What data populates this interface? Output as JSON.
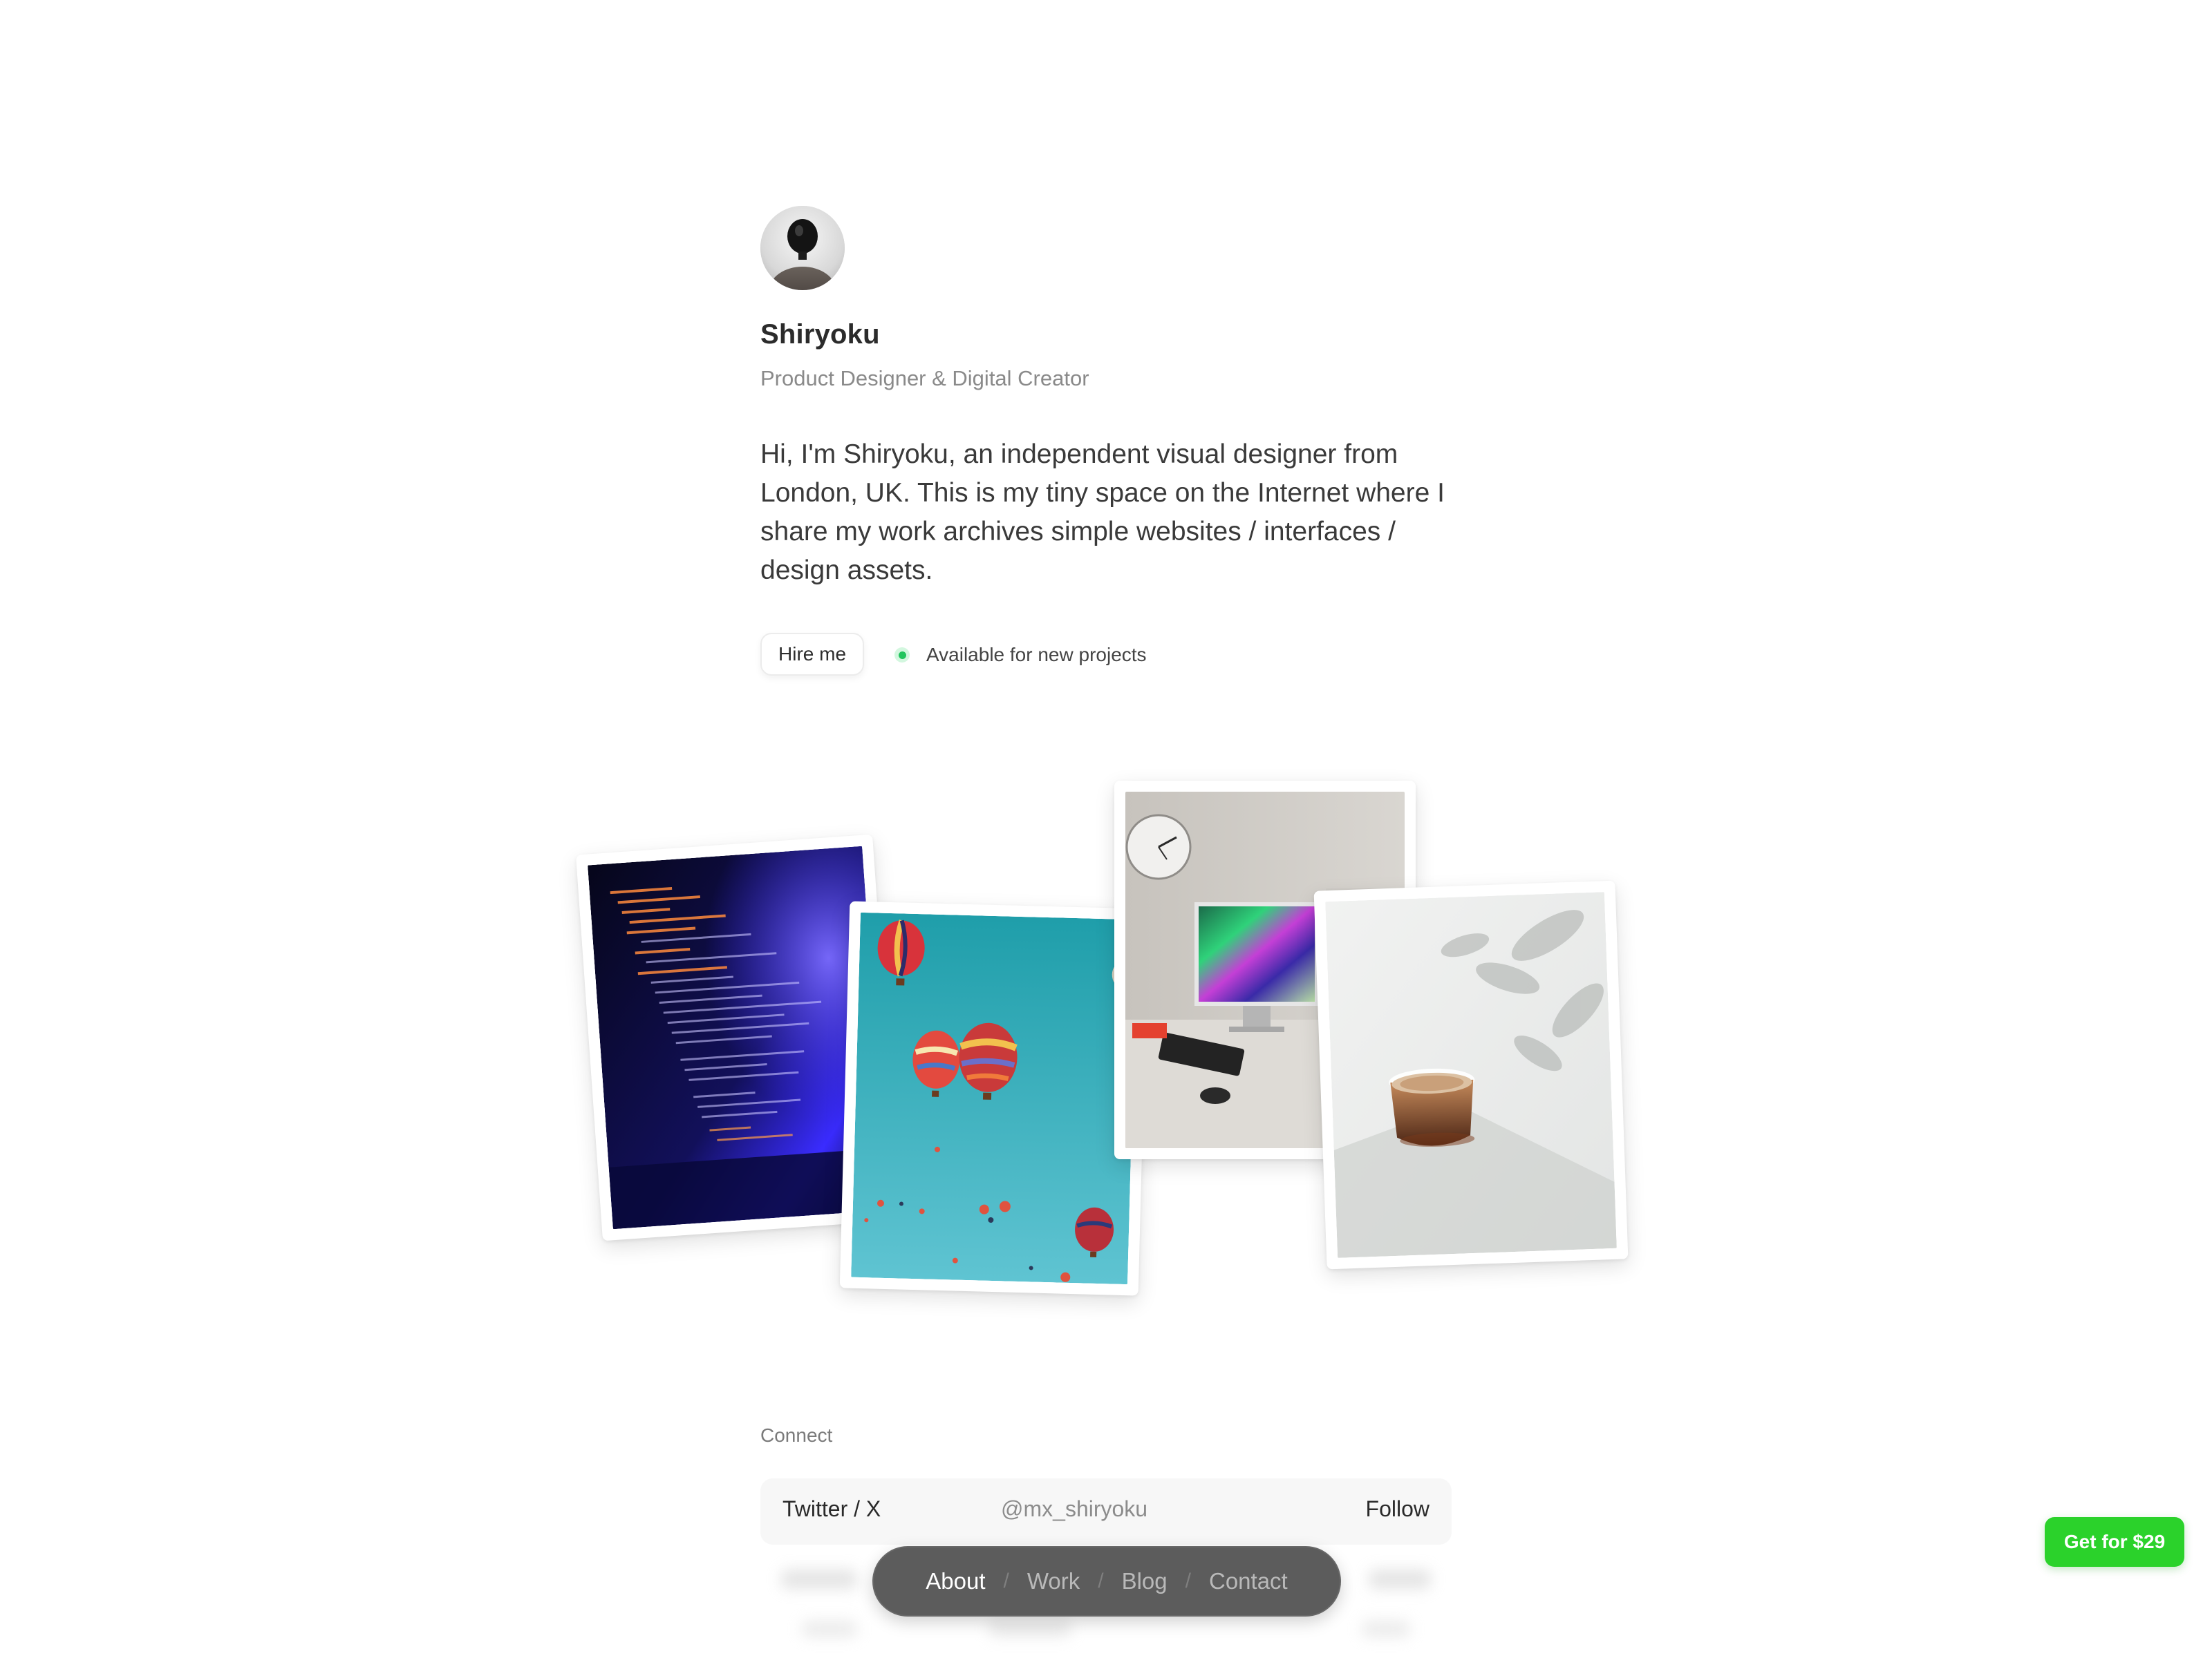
{
  "profile": {
    "name": "Shiryoku",
    "role": "Product Designer & Digital Creator",
    "bio": "Hi, I'm Shiryoku, an independent visual designer from London, UK. This is my tiny space on the Internet where I share my work archives simple websites / interfaces / design assets."
  },
  "actions": {
    "hire_label": "Hire me",
    "status_text": "Available for new projects",
    "status_color": "#22c55e"
  },
  "gallery": [
    {
      "name": "code-screen-photo"
    },
    {
      "name": "hot-air-balloons-photo"
    },
    {
      "name": "desk-setup-photo"
    },
    {
      "name": "coffee-glass-photo"
    }
  ],
  "connect": {
    "label": "Connect",
    "rows": [
      {
        "platform": "Twitter / X",
        "handle": "@mx_shiryoku",
        "action": "Follow"
      }
    ]
  },
  "nav": {
    "items": [
      {
        "label": "About",
        "active": true
      },
      {
        "label": "Work",
        "active": false
      },
      {
        "label": "Blog",
        "active": false
      },
      {
        "label": "Contact",
        "active": false
      }
    ],
    "separator": "/"
  },
  "buy": {
    "label": "Get for $29",
    "color": "#2bd22b"
  }
}
